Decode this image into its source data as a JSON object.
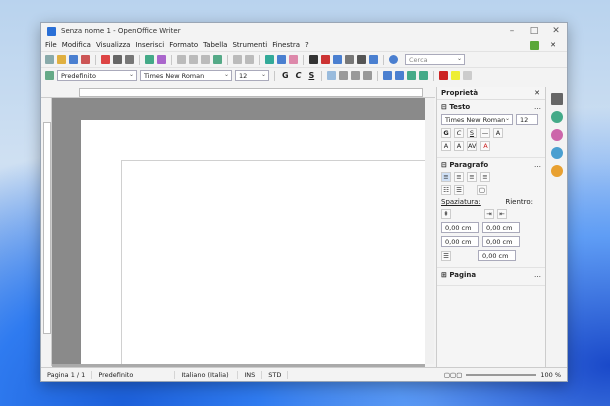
{
  "window": {
    "title": "Senza nome 1 - OpenOffice Writer",
    "min_icon": "minimize-icon",
    "max_icon": "maximize-icon",
    "close_icon": "close-icon"
  },
  "menu": [
    "File",
    "Modifica",
    "Visualizza",
    "Inserisci",
    "Formato",
    "Tabella",
    "Strumenti",
    "Finestra",
    "?"
  ],
  "formatting": {
    "style": "Predefinito",
    "font": "Times New Roman",
    "size": "12",
    "bold": "G",
    "italic": "C",
    "underline": "S"
  },
  "find_placeholder": "Cerca",
  "sidebar": {
    "title": "Proprietà",
    "testo": {
      "title": "Testo",
      "font": "Times New Roman",
      "size": "12"
    },
    "paragrafo": {
      "title": "Paragrafo",
      "spaziatura": "Spaziatura:",
      "rientro": "Rientro:",
      "v1": "0,00 cm",
      "v2": "0,00 cm",
      "v3": "0,00 cm",
      "v4": "0,00 cm",
      "v5": "0,00 cm"
    },
    "pagina": {
      "title": "Pagina"
    }
  },
  "status": {
    "page": "Pagina 1 / 1",
    "style": "Predefinito",
    "lang": "Italiano (Italia)",
    "ins": "INS",
    "std": "STD",
    "zoom": "100 %"
  },
  "colors": {
    "accent": "#2a6fd6"
  }
}
